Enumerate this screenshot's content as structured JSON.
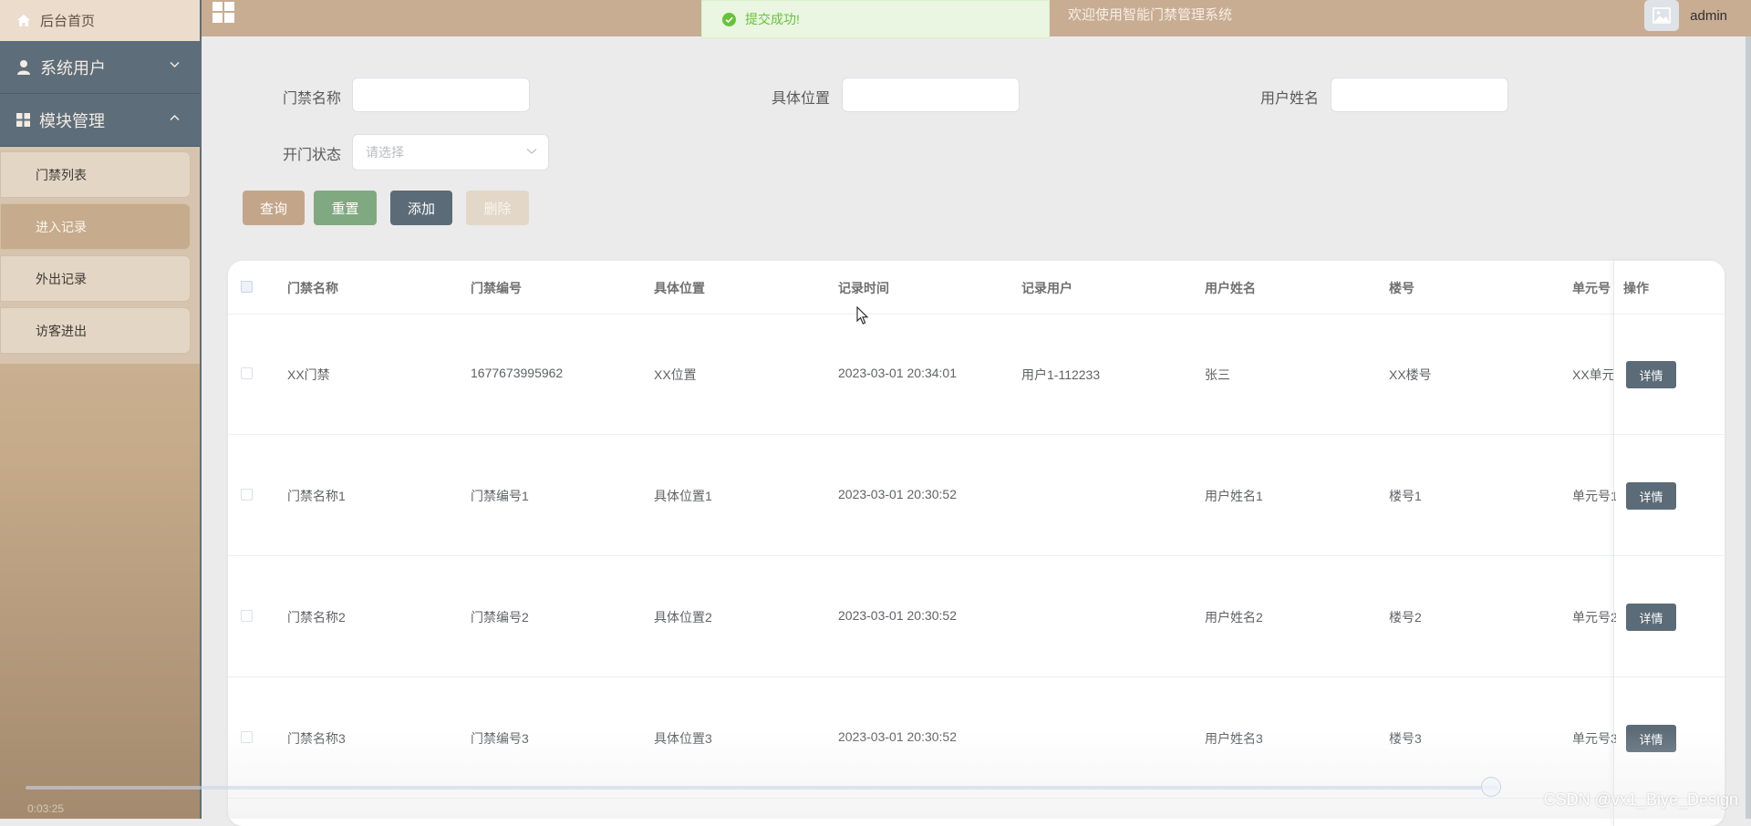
{
  "sidebar": {
    "home_label": "后台首页",
    "groups": [
      {
        "label": "系统用户",
        "expanded": false
      },
      {
        "label": "模块管理",
        "expanded": true
      }
    ],
    "sub_items": [
      {
        "label": "门禁列表",
        "active": false
      },
      {
        "label": "进入记录",
        "active": true
      },
      {
        "label": "外出记录",
        "active": false
      },
      {
        "label": "访客进出",
        "active": false
      }
    ]
  },
  "header": {
    "title": "欢迎使用智能门禁管理系统",
    "username": "admin"
  },
  "toast": {
    "message": "提交成功!",
    "type": "success"
  },
  "search": {
    "door_name_label": "门禁名称",
    "location_label": "具体位置",
    "user_name_label": "用户姓名",
    "open_status_label": "开门状态",
    "open_status_placeholder": "请选择",
    "door_name_value": "",
    "location_value": "",
    "user_name_value": ""
  },
  "buttons": {
    "query": "查询",
    "reset": "重置",
    "add": "添加",
    "delete": "删除"
  },
  "table": {
    "columns": [
      "门禁名称",
      "门禁编号",
      "具体位置",
      "记录时间",
      "记录用户",
      "用户姓名",
      "楼号",
      "单元号",
      "操作"
    ],
    "detail_label": "详情",
    "rows": [
      {
        "door_name": "XX门禁",
        "door_no": "1677673995962",
        "location": "XX位置",
        "time": "2023-03-01 20:34:01",
        "record_user": "用户1-112233",
        "user_name": "张三",
        "building": "XX楼号",
        "unit": "XX单元"
      },
      {
        "door_name": "门禁名称1",
        "door_no": "门禁编号1",
        "location": "具体位置1",
        "time": "2023-03-01 20:30:52",
        "record_user": "",
        "user_name": "用户姓名1",
        "building": "楼号1",
        "unit": "单元号1"
      },
      {
        "door_name": "门禁名称2",
        "door_no": "门禁编号2",
        "location": "具体位置2",
        "time": "2023-03-01 20:30:52",
        "record_user": "",
        "user_name": "用户姓名2",
        "building": "楼号2",
        "unit": "单元号2"
      },
      {
        "door_name": "门禁名称3",
        "door_no": "门禁编号3",
        "location": "具体位置3",
        "time": "2023-03-01 20:30:52",
        "record_user": "",
        "user_name": "用户姓名3",
        "building": "楼号3",
        "unit": "单元号3"
      }
    ]
  },
  "video": {
    "time": "0:03:25"
  },
  "watermark": "CSDN @vx1_Biye_Design",
  "colors": {
    "sidebar_group": "#5d6d79",
    "active_item": "#c6ab8c",
    "topbar": "#c8ad93",
    "btn_query": "#c3a68a",
    "btn_reset": "#80a981",
    "btn_add": "#5b6b77",
    "btn_delete": "#e3d7c8",
    "toast_success": "#67c23a"
  }
}
